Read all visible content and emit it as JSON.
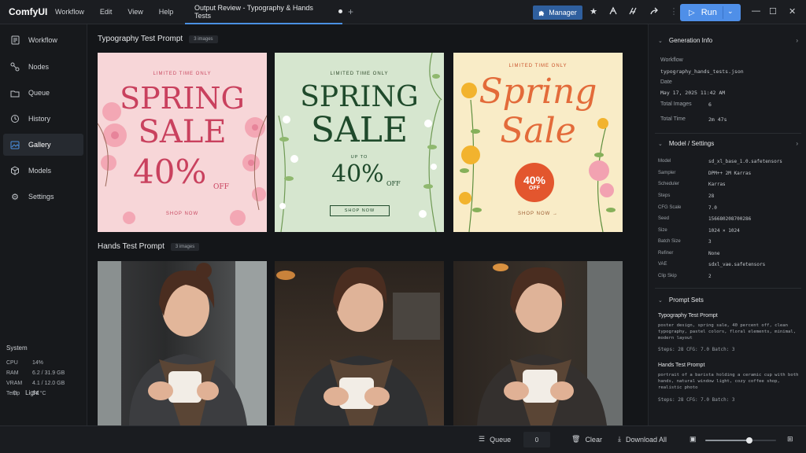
{
  "app": {
    "title": "ComfyUI"
  },
  "menu": [
    "Workflow",
    "Edit",
    "View",
    "Help"
  ],
  "tab": {
    "title": "Output Review - Typography & Hands Tests"
  },
  "toolbar": {
    "manager_label": "Manager",
    "run_label": "Run"
  },
  "sidebar": {
    "items": [
      {
        "label": "Workflow",
        "icon": "workflow-icon"
      },
      {
        "label": "Nodes",
        "icon": "nodes-icon"
      },
      {
        "label": "Queue",
        "icon": "queue-icon"
      },
      {
        "label": "History",
        "icon": "history-icon"
      },
      {
        "label": "Gallery",
        "icon": "gallery-icon",
        "active": true
      },
      {
        "label": "Models",
        "icon": "models-icon"
      },
      {
        "label": "Settings",
        "icon": "settings-icon"
      }
    ],
    "system": {
      "title": "System",
      "rows": [
        {
          "k": "CPU",
          "v": "14%"
        },
        {
          "k": "RAM",
          "v": "6.2 / 31.9 GB"
        },
        {
          "k": "VRAM",
          "v": "4.1 / 12.0 GB"
        },
        {
          "k": "Temp",
          "v": "54 °C"
        }
      ]
    },
    "theme_label": "Light"
  },
  "sections": {
    "typography": {
      "title": "Typography Test Prompt",
      "badge": "3 images",
      "cards": [
        {
          "top": "LIMITED TIME ONLY",
          "line1": "SPRING",
          "line2": "SALE",
          "pct": "40%",
          "off": "OFF",
          "cta": "SHOP NOW"
        },
        {
          "top": "LIMITED TIME ONLY",
          "line1": "SPRING",
          "line2": "SALE",
          "upto": "UP TO",
          "pct": "40%",
          "off": "OFF",
          "cta": "SHOP NOW"
        },
        {
          "top": "LIMITED TIME ONLY",
          "line1": "Spring",
          "line2": "Sale",
          "pct": "40%",
          "off": "OFF",
          "cta": "SHOP NOW →"
        }
      ]
    },
    "hands": {
      "title": "Hands Test Prompt",
      "badge": "3 images"
    }
  },
  "right_panel": {
    "generation_info": {
      "title": "Generation Info",
      "workflow_label": "Workflow",
      "workflow_value": "typography_hands_tests.json",
      "date_label": "Date",
      "date_value": "May 17, 2025  11:42 AM",
      "total_images_label": "Total Images",
      "total_images_value": "6",
      "total_time_label": "Total Time",
      "total_time_value": "2m 47s"
    },
    "model_settings": {
      "title": "Model / Settings",
      "rows": [
        {
          "k": "Model",
          "v": "sd_xl_base_1.0.safetensors"
        },
        {
          "k": "Sampler",
          "v": "DPM++ 2M Karras"
        },
        {
          "k": "Scheduler",
          "v": "Karras"
        },
        {
          "k": "Steps",
          "v": "28"
        },
        {
          "k": "CFG Scale",
          "v": "7.0"
        },
        {
          "k": "Seed",
          "v": "156680208700286"
        },
        {
          "k": "Size",
          "v": "1024 × 1024"
        },
        {
          "k": "Batch Size",
          "v": "3"
        },
        {
          "k": "Refiner",
          "v": "None"
        },
        {
          "k": "VAE",
          "v": "sdxl_vae.safetensors"
        },
        {
          "k": "Clip Skip",
          "v": "2"
        }
      ]
    },
    "prompt_sets": {
      "title": "Prompt Sets",
      "items": [
        {
          "name": "Typography Test Prompt",
          "text": "poster design, spring sale, 40 percent off, clean typography, pastel colors, floral elements, minimal, modern layout",
          "meta": "Steps: 28   CFG: 7.0   Batch: 3"
        },
        {
          "name": "Hands Test Prompt",
          "text": "portrait of a barista holding a ceramic cup with both hands, natural window light, cozy coffee shop, realistic photo",
          "meta": "Steps: 28   CFG: 7.0   Batch: 3"
        }
      ]
    }
  },
  "bottom_bar": {
    "queue_label": "Queue",
    "queue_count": "0",
    "clear_label": "Clear",
    "download_label": "Download All",
    "zoom_level": 0.62
  }
}
